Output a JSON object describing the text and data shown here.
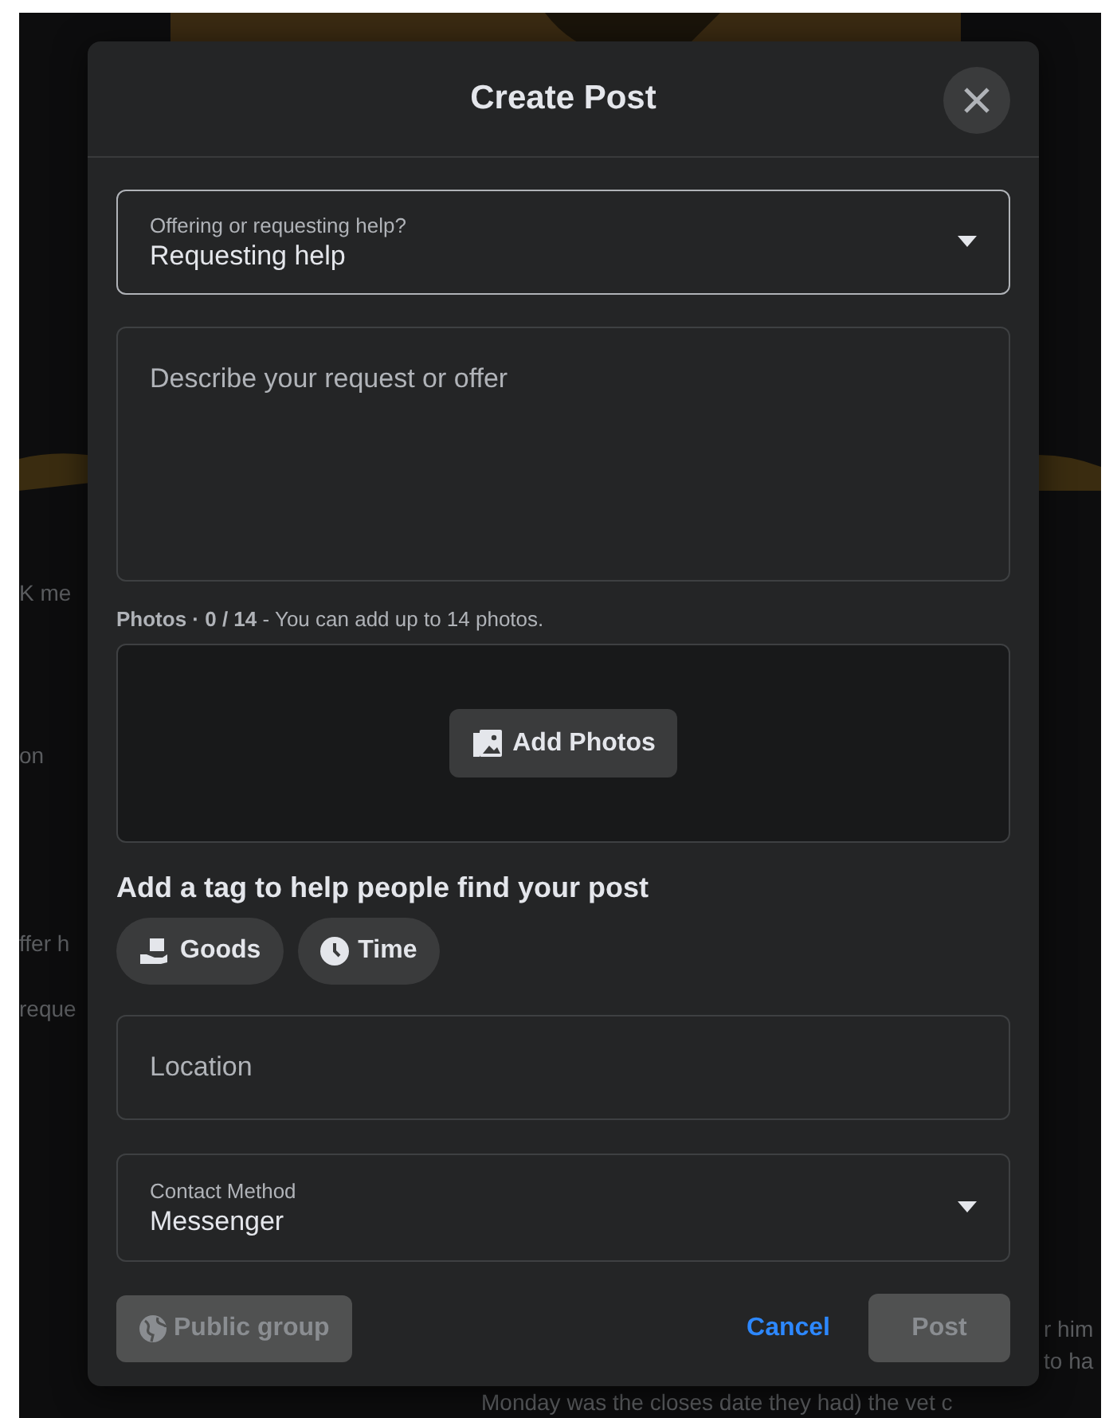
{
  "background": {
    "fragments": [
      "K me",
      "on",
      "ffer h",
      "reque",
      "r him",
      "to ha",
      "Monday was the closes date they had) the vet c"
    ]
  },
  "dialog": {
    "title": "Create Post",
    "help_type": {
      "label": "Offering or requesting help?",
      "value": "Requesting help"
    },
    "description": {
      "placeholder": "Describe your request or offer"
    },
    "photos": {
      "label": "Photos · 0 / 14",
      "hint": "- You can add up to 14 photos.",
      "button": "Add Photos"
    },
    "tags_heading": "Add a tag to help people find your post",
    "tags": [
      {
        "kind": "goods",
        "label": "Goods",
        "selected": false
      },
      {
        "kind": "time",
        "label": "Time",
        "selected": false
      }
    ],
    "location": {
      "placeholder": "Location"
    },
    "contact": {
      "label": "Contact Method",
      "value": "Messenger"
    },
    "footer": {
      "audience": {
        "label": "Public group",
        "disabled": true
      },
      "cancel": "Cancel",
      "post": {
        "label": "Post",
        "disabled": true
      }
    }
  }
}
